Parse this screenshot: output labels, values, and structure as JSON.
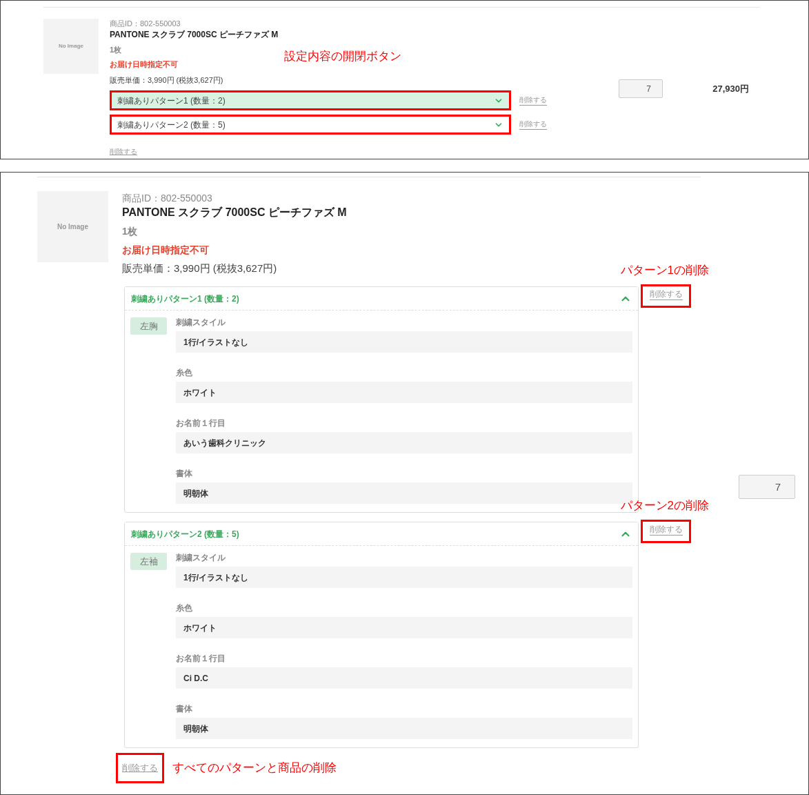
{
  "panels": [
    {
      "kind": "compact",
      "image_label": "No Image",
      "product_id": "商品ID：802-550003",
      "name": "PANTONE スクラブ 7000SC ピーチファズ M",
      "unit": "1枚",
      "delivery_note": "お届け日時指定不可",
      "price": "販売単価：3,990円 (税抜3,627円)",
      "callout": "設定内容の開閉ボタン",
      "patterns": [
        {
          "title": "刺繍ありパターン1 (数量：2)",
          "expanded": false,
          "hovered": true,
          "header_highlighted": true,
          "delete": "削除する",
          "delete_highlighted": false
        },
        {
          "title": "刺繍ありパターン2 (数量：5)",
          "expanded": false,
          "hovered": false,
          "header_highlighted": true,
          "delete": "削除する",
          "delete_highlighted": false
        }
      ],
      "delete_all": {
        "label": "削除する",
        "highlighted": false
      },
      "quantity": "7",
      "total": "27,930円"
    },
    {
      "kind": "large",
      "image_label": "No Image",
      "product_id": "商品ID：802-550003",
      "name": "PANTONE スクラブ 7000SC ピーチファズ M",
      "unit": "1枚",
      "delivery_note": "お届け日時指定不可",
      "price": "販売単価：3,990円 (税抜3,627円)",
      "patterns": [
        {
          "title": "刺繍ありパターン1 (数量：2)",
          "expanded": true,
          "hovered": false,
          "header_highlighted": false,
          "delete": "削除する",
          "delete_highlighted": true,
          "delete_callout": "パターン1の削除",
          "position": "左胸",
          "fields": [
            {
              "label": "刺繍スタイル",
              "value": "1行/イラストなし"
            },
            {
              "label": "糸色",
              "value": "ホワイト"
            },
            {
              "label": "お名前１行目",
              "value": "あいう歯科クリニック"
            },
            {
              "label": "書体",
              "value": "明朝体"
            }
          ]
        },
        {
          "title": "刺繍ありパターン2 (数量：5)",
          "expanded": true,
          "hovered": false,
          "header_highlighted": false,
          "delete": "削除する",
          "delete_highlighted": true,
          "delete_callout": "パターン2の削除",
          "position": "左袖",
          "fields": [
            {
              "label": "刺繍スタイル",
              "value": "1行/イラストなし"
            },
            {
              "label": "糸色",
              "value": "ホワイト"
            },
            {
              "label": "お名前１行目",
              "value": "Ci D.C"
            },
            {
              "label": "書体",
              "value": "明朝体"
            }
          ]
        }
      ],
      "delete_all": {
        "label": "削除する",
        "highlighted": true,
        "callout": "すべてのパターンと商品の削除"
      },
      "quantity": "7"
    }
  ]
}
